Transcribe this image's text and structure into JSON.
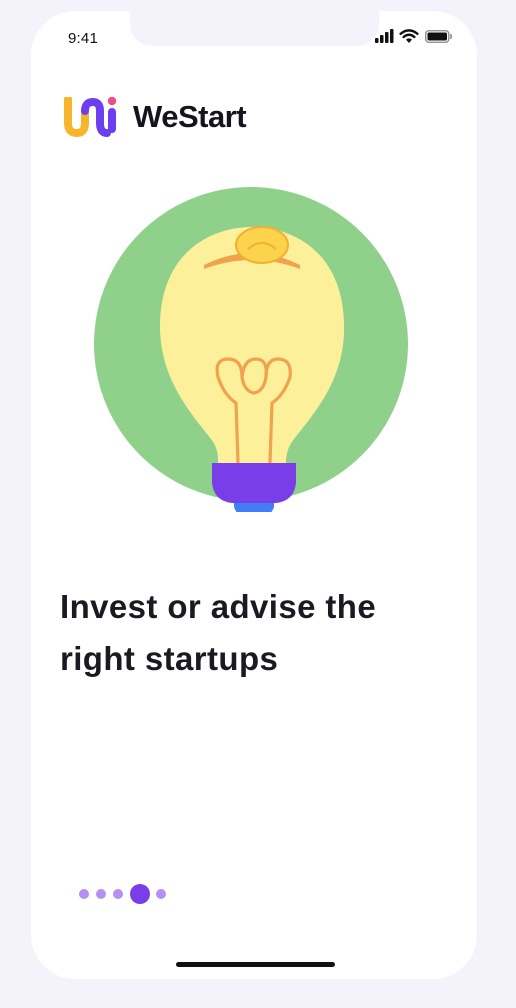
{
  "status_bar": {
    "time": "9:41"
  },
  "brand": {
    "name": "WeStart"
  },
  "onboarding": {
    "headline": "Invest or advise the right startups",
    "illustration_icon": "lightbulb-with-coin",
    "page_count": 5,
    "active_page": 4
  },
  "colors": {
    "circle_green": "#8fd18b",
    "bulb_yellow": "#fdf09a",
    "filament_orange": "#f0a24f",
    "bulb_base_purple": "#7a3ee8",
    "bulb_tip_blue": "#3f7ef4",
    "coin_yellow": "#fcd34d",
    "dot_active": "#7a3ee8",
    "dot_inactive": "#b68ff2"
  }
}
